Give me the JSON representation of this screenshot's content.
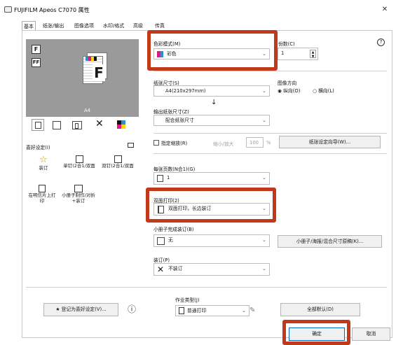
{
  "window": {
    "title": "FUJIFILM Apeos C7070 属性",
    "close_glyph": "✕"
  },
  "tabs": [
    "基本",
    "纸张/输出",
    "图像选项",
    "水印/格式",
    "高级",
    "传真"
  ],
  "left": {
    "preview_size": "A4",
    "favorites_label": "喜好设定(I)",
    "favorites": [
      {
        "label": "装订",
        "icon": "star-outline-icon"
      },
      {
        "label": "单钉(2合1/双面",
        "icon": "staple-2up-icon"
      },
      {
        "label": "双钉(2合1/双面",
        "icon": "double-staple-2up-icon"
      },
      {
        "label": "在明信片上打印",
        "icon": "postcard-icon"
      },
      {
        "label": "小册子制作/对折+装订",
        "icon": "booklet-icon"
      }
    ],
    "save_favorite": "登记为喜好设定(V)...",
    "info_glyph": "ⓘ"
  },
  "right": {
    "color_mode": {
      "label": "色彩模式(M)",
      "value": "彩色"
    },
    "copies": {
      "label": "份数(C)",
      "value": "1"
    },
    "help_glyph": "?",
    "paper_size": {
      "label": "纸张尺寸(S)",
      "value": "A4(210x297mm)"
    },
    "orientation": {
      "label": "图像方向",
      "portrait": "纵向(O)",
      "landscape": "横向(L)"
    },
    "arrow_glyph": "↓",
    "output_size": {
      "label": "输出纸张尺寸(Z)",
      "value": "配合纸张尺寸"
    },
    "scale": {
      "checkbox_label": "指定缩放(R)",
      "zoom_label": "缩小/放大",
      "value": "100",
      "unit": "%"
    },
    "paper_wizard": "纸张设定向导(W)...",
    "pages_per_sheet": {
      "label": "每张页数(N合1)(G)",
      "value": "1"
    },
    "duplex": {
      "label": "双面打印(2)",
      "value": "双面打印，长边装订"
    },
    "booklet": {
      "label": "小册子完成装订(B)",
      "value": "无"
    },
    "booklet_button": "小册子/海报/混合尺寸原稿(K)...",
    "staple": {
      "label": "装订(P)",
      "value": "不装订"
    },
    "job_type": {
      "label": "作业类型(J)",
      "value": "普通打印"
    },
    "defaults_button": "全部默认(D)"
  },
  "footer": {
    "ok": "确定",
    "cancel": "取消"
  },
  "colors": {
    "highlight": "#c0391b",
    "preview_bg": "#9a9a9a",
    "accent": "#0067c0"
  }
}
